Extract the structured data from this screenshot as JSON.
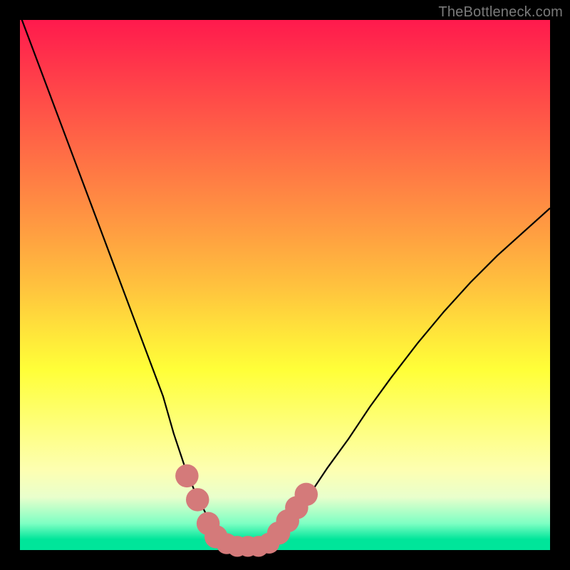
{
  "watermark": "TheBottleneck.com",
  "colors": {
    "frame": "#000000",
    "curve": "#000000",
    "marker": "#d47a7a",
    "gradient_top": "#ff1a4d",
    "gradient_bottom": "#00e59a"
  },
  "chart_data": {
    "type": "line",
    "title": "",
    "xlabel": "",
    "ylabel": "",
    "xlim": [
      0,
      100
    ],
    "ylim": [
      0,
      100
    ],
    "series": [
      {
        "name": "bottleneck-curve",
        "x": [
          0,
          3,
          6,
          9,
          12,
          15,
          18,
          21,
          24,
          27,
          29,
          31,
          33,
          35,
          36.5,
          38,
          40,
          42,
          44,
          46,
          48,
          50,
          52,
          55,
          58,
          62,
          66,
          70,
          75,
          80,
          85,
          90,
          95,
          100
        ],
        "values": [
          101,
          93,
          85,
          77,
          69,
          61,
          53,
          45,
          37,
          29,
          22,
          16,
          11,
          7,
          4,
          2,
          0.8,
          0.3,
          0.3,
          0.8,
          2,
          4.2,
          7,
          11,
          15.5,
          21,
          27,
          32.5,
          39,
          45,
          50.5,
          55.5,
          60,
          64.5
        ]
      }
    ],
    "markers": [
      {
        "x": 31.5,
        "y": 14,
        "size": 4.2
      },
      {
        "x": 33.5,
        "y": 9.5,
        "size": 4.2
      },
      {
        "x": 35.5,
        "y": 5,
        "size": 4.2
      },
      {
        "x": 37,
        "y": 2.5,
        "size": 4.2
      },
      {
        "x": 39,
        "y": 1.2,
        "size": 3.8
      },
      {
        "x": 41,
        "y": 0.7,
        "size": 3.8
      },
      {
        "x": 43,
        "y": 0.7,
        "size": 3.8
      },
      {
        "x": 45,
        "y": 0.7,
        "size": 3.8
      },
      {
        "x": 47,
        "y": 1.3,
        "size": 3.8
      },
      {
        "x": 48.8,
        "y": 3.2,
        "size": 4.2
      },
      {
        "x": 50.5,
        "y": 5.5,
        "size": 4.2
      },
      {
        "x": 52.2,
        "y": 8,
        "size": 4.2
      },
      {
        "x": 54,
        "y": 10.5,
        "size": 4.2
      }
    ],
    "annotations": []
  }
}
